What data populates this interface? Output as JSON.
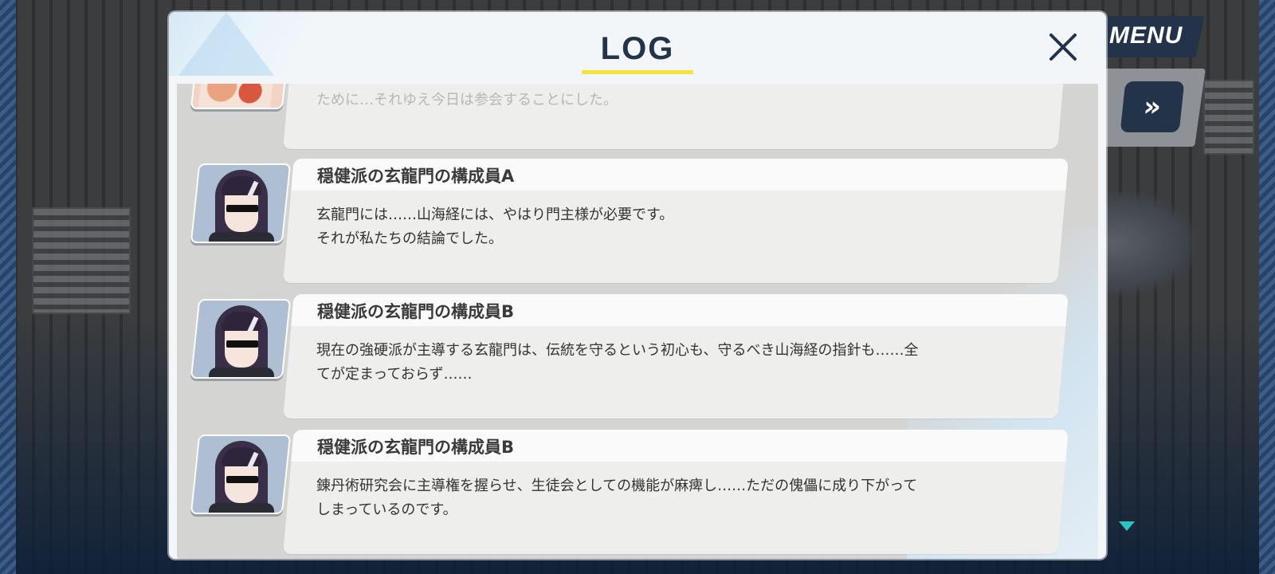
{
  "hud": {
    "menu_label": "MENU",
    "fast_forward_label": "»"
  },
  "log": {
    "title": "LOG",
    "close_label": "×",
    "partial_entry_text": "ために…それゆえ今日は参会することにした。",
    "entries": [
      {
        "speaker": "穏健派の玄龍門の構成員A",
        "lines": [
          "玄龍門には……山海経には、やはり門主様が必要です。",
          "それが私たちの結論でした。"
        ]
      },
      {
        "speaker": "穏健派の玄龍門の構成員B",
        "lines": [
          "現在の強硬派が主導する玄龍門は、伝統を守るという初心も、守るべき山海経の指針も……全",
          "てが定まっておらず……"
        ]
      },
      {
        "speaker": "穏健派の玄龍門の構成員B",
        "lines": [
          "錬丹術研究会に主導権を握らせ、生徒会としての機能が麻痺し……ただの傀儡に成り下がって",
          "しまっているのです。"
        ]
      }
    ]
  },
  "colors": {
    "accent_yellow": "#f5e23a",
    "navy": "#23334a",
    "scroll_arrow": "#2cc2c9"
  },
  "icons": {
    "close": "close-icon",
    "fast_forward": "fast-forward-icon",
    "scroll_down": "triangle-down-icon"
  }
}
